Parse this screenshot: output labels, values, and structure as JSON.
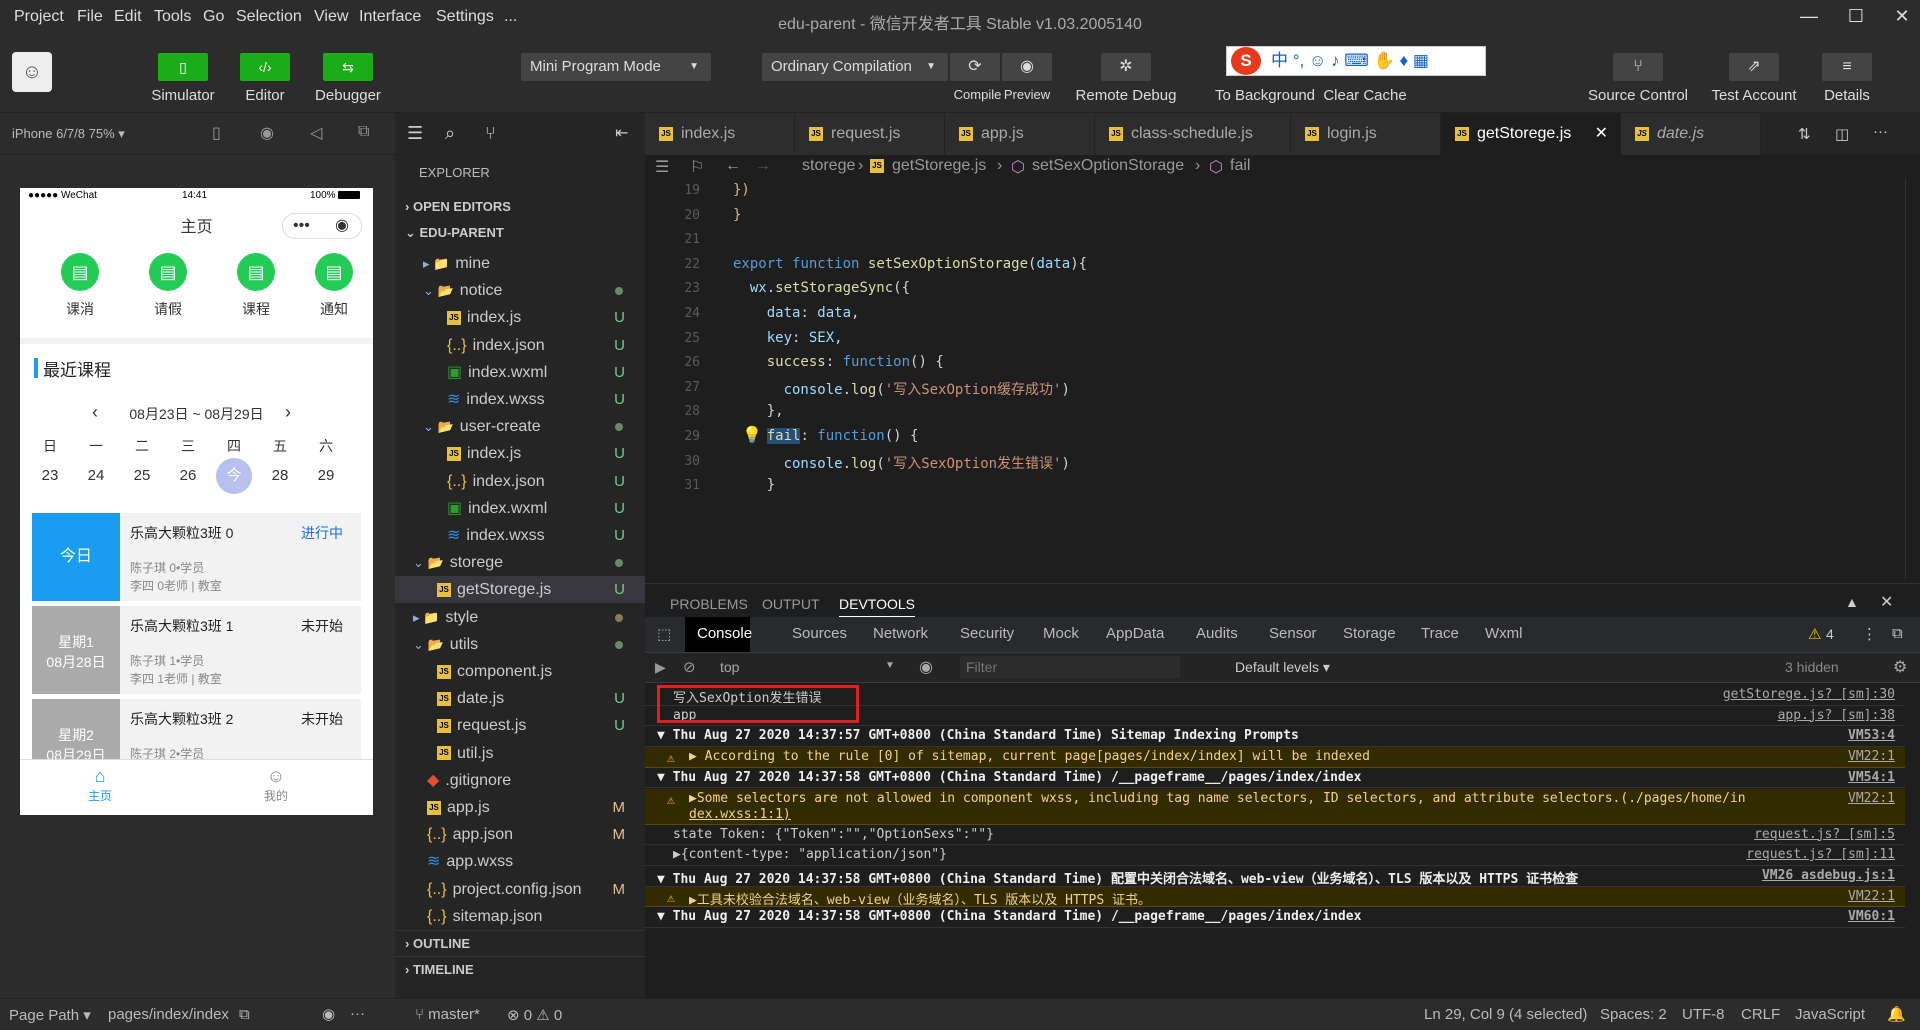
{
  "menu": [
    "Project",
    "File",
    "Edit",
    "Tools",
    "Go",
    "Selection",
    "View",
    "Interface",
    "Settings",
    "..."
  ],
  "window_title": "edu-parent - 微信开发者工具 Stable v1.03.2005140",
  "toolbar": {
    "simulator": "Simulator",
    "editor": "Editor",
    "debugger": "Debugger",
    "mode": "Mini Program Mode",
    "compile_mode": "Ordinary Compilation",
    "compile": "Compile",
    "preview": "Preview",
    "remote_debug": "Remote Debug",
    "to_background": "To Background",
    "clear_cache": "Clear Cache",
    "source_control": "Source Control",
    "test_account": "Test Account",
    "details": "Details",
    "ime_text": "中 °,"
  },
  "sim": {
    "device": "iPhone 6/7/8 75%",
    "carrier": "●●●●● WeChat",
    "time": "14:41",
    "battery": "100%",
    "page_title": "主页",
    "icons": [
      "课消",
      "请假",
      "课程",
      "通知"
    ],
    "section_title": "最近课程",
    "date_range": "08月23日 ~ 08月29日",
    "weekdays": [
      "日",
      "一",
      "二",
      "三",
      "四",
      "五",
      "六"
    ],
    "days": [
      "23",
      "24",
      "25",
      "26",
      "今",
      "28",
      "29"
    ],
    "courses": [
      {
        "side": "今日",
        "name": "乐高大颗粒3班 0",
        "status": "进行中",
        "line1": "陈子琪 0•学员",
        "line2": "李四 0老师 | 教室"
      },
      {
        "side": "星期1\n08月28日",
        "side1": "星期1",
        "side2": "08月28日",
        "name": "乐高大颗粒3班 1",
        "status": "未开始",
        "line1": "陈子琪 1•学员",
        "line2": "李四 1老师 | 教室"
      },
      {
        "side1": "星期2",
        "side2": "08月29日",
        "name": "乐高大颗粒3班 2",
        "status": "未开始",
        "line1": "陈子琪 2•学员",
        "line2": ""
      }
    ],
    "tab_home": "主页",
    "tab_mine": "我的"
  },
  "explorer": {
    "title": "EXPLORER",
    "open_editors": "OPEN EDITORS",
    "project": "EDU-PARENT",
    "outline": "OUTLINE",
    "timeline": "TIMELINE",
    "tree": [
      {
        "name": "mine",
        "badge": ""
      },
      {
        "name": "notice",
        "badge": ""
      },
      {
        "name": "index.js",
        "badge": "U"
      },
      {
        "name": "index.json",
        "badge": "U"
      },
      {
        "name": "index.wxml",
        "badge": "U"
      },
      {
        "name": "index.wxss",
        "badge": "U"
      },
      {
        "name": "user-create",
        "badge": ""
      },
      {
        "name": "index.js",
        "badge": "U"
      },
      {
        "name": "index.json",
        "badge": "U"
      },
      {
        "name": "index.wxml",
        "badge": "U"
      },
      {
        "name": "index.wxss",
        "badge": "U"
      },
      {
        "name": "storege",
        "badge": ""
      },
      {
        "name": "getStorege.js",
        "badge": "U"
      },
      {
        "name": "style",
        "badge": ""
      },
      {
        "name": "utils",
        "badge": ""
      },
      {
        "name": "component.js",
        "badge": ""
      },
      {
        "name": "date.js",
        "badge": "U"
      },
      {
        "name": "request.js",
        "badge": "U"
      },
      {
        "name": "util.js",
        "badge": ""
      },
      {
        "name": ".gitignore",
        "badge": ""
      },
      {
        "name": "app.js",
        "badge": "M"
      },
      {
        "name": "app.json",
        "badge": "M"
      },
      {
        "name": "app.wxss",
        "badge": ""
      },
      {
        "name": "project.config.json",
        "badge": "M"
      },
      {
        "name": "sitemap.json",
        "badge": ""
      }
    ]
  },
  "tabs": [
    "index.js",
    "request.js",
    "app.js",
    "class-schedule.js",
    "login.js",
    "getStorege.js",
    "date.js"
  ],
  "breadcrumb": [
    "storege",
    "getStorege.js",
    "setSexOptionStorage",
    "fail"
  ],
  "code_lines": [
    "19",
    "20",
    "21",
    "22",
    "23",
    "24",
    "25",
    "26",
    "27",
    "28",
    "29",
    "30",
    "31"
  ],
  "panel": {
    "tabs": [
      "PROBLEMS",
      "OUTPUT",
      "DEVTOOLS"
    ],
    "devtabs": [
      "Console",
      "Sources",
      "Network",
      "Security",
      "Mock",
      "AppData",
      "Audits",
      "Sensor",
      "Storage",
      "Trace",
      "Wxml"
    ],
    "warn_count": "4",
    "context": "top",
    "filter_placeholder": "Filter",
    "levels": "Default levels",
    "hidden": "3 hidden",
    "console": [
      {
        "text": "写入SexOption发生错误",
        "src": "getStorege.js? [sm]:30",
        "kind": "log"
      },
      {
        "text": "app",
        "src": "app.js? [sm]:38",
        "kind": "log"
      },
      {
        "text": "▼ Thu Aug 27 2020 14:37:57 GMT+0800 (China Standard Time) Sitemap Indexing Prompts",
        "src": "VM53:4",
        "kind": "grp"
      },
      {
        "text": "▶ According to the rule [0] of sitemap, current page[pages/index/index] will be indexed",
        "src": "VM22:1",
        "kind": "warn"
      },
      {
        "text": "▼ Thu Aug 27 2020 14:37:58 GMT+0800 (China Standard Time) /__pageframe__/pages/index/index",
        "src": "VM54:1",
        "kind": "grp"
      },
      {
        "text": "▶Some selectors are not allowed in component wxss, including tag name selectors, ID selectors, and attribute selectors.(./pages/home/in",
        "src": "VM22:1",
        "kind": "warn2",
        "text2": "dex.wxss:1:1)"
      },
      {
        "text": "state Token: {\"Token\":\"\",\"OptionSexs\":\"\"}",
        "src": "request.js? [sm]:5",
        "kind": "log"
      },
      {
        "text": "▶{content-type: \"application/json\"}",
        "src": "request.js? [sm]:11",
        "kind": "log"
      },
      {
        "text": "▼ Thu Aug 27 2020 14:37:58 GMT+0800 (China Standard Time) 配置中关闭合法域名、web-view（业务域名）、TLS 版本以及 HTTPS 证书检查",
        "src": "VM26 asdebug.js:1",
        "kind": "grp"
      },
      {
        "text": "▶工具未校验合法域名、web-view（业务域名）、TLS 版本以及 HTTPS 证书。",
        "src": "VM22:1",
        "kind": "warn"
      },
      {
        "text": "▼ Thu Aug 27 2020 14:37:58 GMT+0800 (China Standard Time) /__pageframe__/pages/index/index",
        "src": "VM60:1",
        "kind": "grp"
      }
    ]
  },
  "statusbar": {
    "page_path_label": "Page Path",
    "page_path": "pages/index/index",
    "branch": "master*",
    "problems": "⊗ 0 ⚠ 0",
    "cursor": "Ln 29, Col 9 (4 selected)",
    "spaces": "Spaces: 2",
    "encoding": "UTF-8",
    "eol": "CRLF",
    "language": "JavaScript"
  },
  "colors": {
    "accent_green": "#1aad19",
    "highlight_box": "#e02020",
    "phone_blue": "#1a9cf0"
  }
}
